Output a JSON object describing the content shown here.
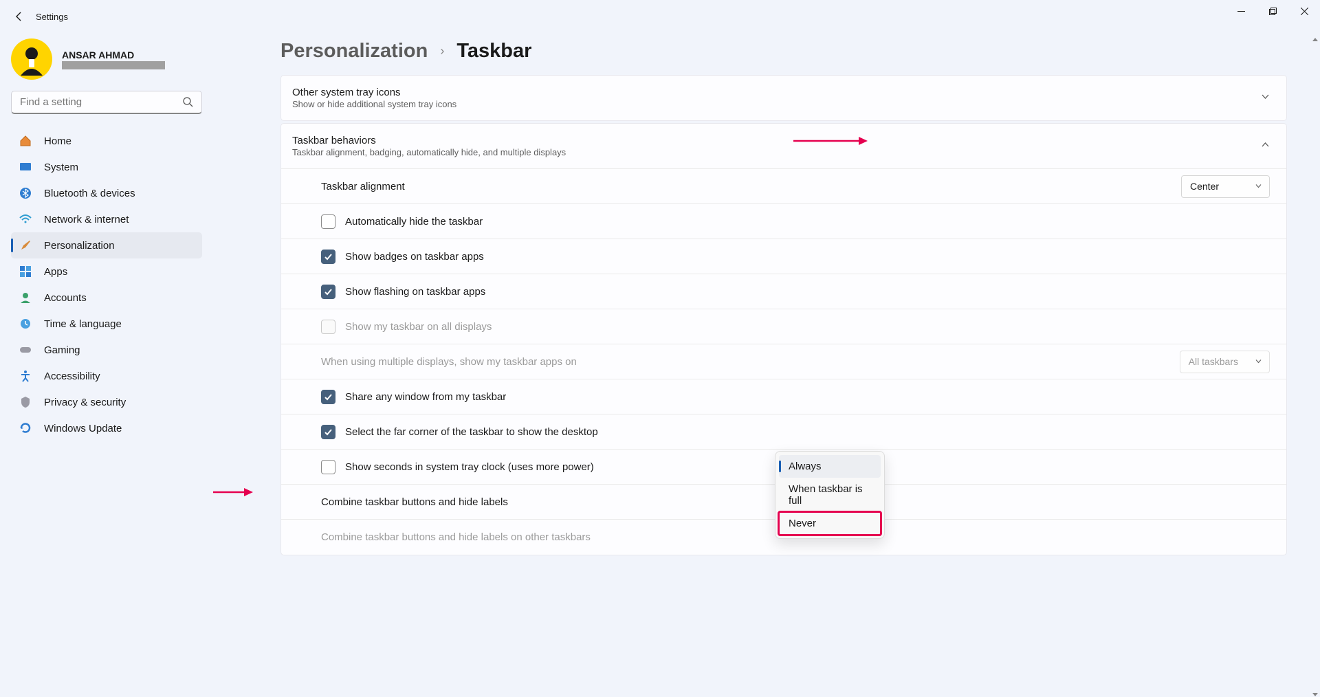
{
  "window": {
    "title": "Settings"
  },
  "profile": {
    "name": "ANSAR AHMAD"
  },
  "search": {
    "placeholder": "Find a setting"
  },
  "nav": [
    {
      "label": "Home",
      "icon": "home"
    },
    {
      "label": "System",
      "icon": "system"
    },
    {
      "label": "Bluetooth & devices",
      "icon": "bluetooth"
    },
    {
      "label": "Network & internet",
      "icon": "wifi"
    },
    {
      "label": "Personalization",
      "icon": "brush",
      "active": true
    },
    {
      "label": "Apps",
      "icon": "apps"
    },
    {
      "label": "Accounts",
      "icon": "person"
    },
    {
      "label": "Time & language",
      "icon": "clock"
    },
    {
      "label": "Gaming",
      "icon": "game"
    },
    {
      "label": "Accessibility",
      "icon": "access"
    },
    {
      "label": "Privacy & security",
      "icon": "shield"
    },
    {
      "label": "Windows Update",
      "icon": "update"
    }
  ],
  "breadcrumb": {
    "parent": "Personalization",
    "current": "Taskbar"
  },
  "cards": {
    "tray": {
      "title": "Other system tray icons",
      "subtitle": "Show or hide additional system tray icons"
    },
    "behaviors": {
      "title": "Taskbar behaviors",
      "subtitle": "Taskbar alignment, badging, automatically hide, and multiple displays"
    }
  },
  "rows": {
    "alignment": {
      "label": "Taskbar alignment",
      "value": "Center"
    },
    "autohide": {
      "label": "Automatically hide the taskbar",
      "checked": false
    },
    "badges": {
      "label": "Show badges on taskbar apps",
      "checked": true
    },
    "flashing": {
      "label": "Show flashing on taskbar apps",
      "checked": true
    },
    "alldisplays": {
      "label": "Show my taskbar on all displays",
      "checked": false,
      "disabled": true
    },
    "multidisp": {
      "label": "When using multiple displays, show my taskbar apps on",
      "value": "All taskbars",
      "disabled": true
    },
    "share": {
      "label": "Share any window from my taskbar",
      "checked": true
    },
    "corner": {
      "label": "Select the far corner of the taskbar to show the desktop",
      "checked": true
    },
    "seconds": {
      "label": "Show seconds in system tray clock (uses more power)",
      "checked": false
    },
    "combine": {
      "label": "Combine taskbar buttons and hide labels"
    },
    "combineother": {
      "label": "Combine taskbar buttons and hide labels on other taskbars",
      "disabled": true
    }
  },
  "popup": {
    "items": [
      "Always",
      "When taskbar is full",
      "Never"
    ],
    "selected": "Always",
    "highlighted": "Never"
  }
}
